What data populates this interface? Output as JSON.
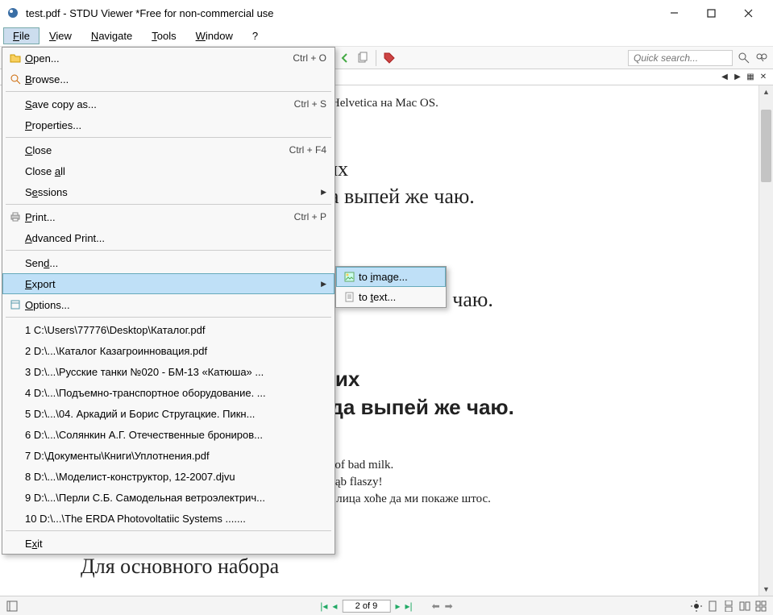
{
  "titlebar": {
    "title": "test.pdf - STDU Viewer *Free for non-commercial use"
  },
  "menubar": {
    "file": "File",
    "view": "View",
    "navigate": "Navigate",
    "tools": "Tools",
    "window": "Window",
    "help": "?"
  },
  "toolbar": {
    "search_placeholder": "Quick search..."
  },
  "fileMenu": {
    "open": "Open...",
    "open_sc": "Ctrl + O",
    "browse": "Browse...",
    "savecopy": "Save copy as...",
    "savecopy_sc": "Ctrl + S",
    "properties": "Properties...",
    "close": "Close",
    "close_sc": "Ctrl + F4",
    "closeall": "Close all",
    "sessions": "Sessions",
    "print": "Print...",
    "print_sc": "Ctrl + P",
    "advprint": "Advanced Print...",
    "send": "Send...",
    "export": "Export",
    "options": "Options...",
    "recent": [
      "1 C:\\Users\\77776\\Desktop\\Каталог.pdf",
      "2 D:\\...\\Каталог Казагроинновация.pdf",
      "3 D:\\...\\Русские танки №020 - БМ-13 «Катюша» ...",
      "4 D:\\...\\Подъемно-транспортное оборудование. ...",
      "5 D:\\...\\04. Аркадий и Борис Стругацкие. Пикн...",
      "6 D:\\...\\Солянкин А.Г. Отечественные брониров...",
      "7 D:\\Документы\\Книги\\Уплотнения.pdf",
      "8 D:\\...\\Моделист-конструктор, 12-2007.djvu",
      "9 D:\\...\\Перли С.Б. Самодельная ветроэлектрич...",
      "10 D:\\...\\The ERDA Photovoltatiic Systems ......."
    ],
    "exit": "Exit"
  },
  "exportSubmenu": {
    "toimage": "to image...",
    "totext": "to text..."
  },
  "document": {
    "topline": "на Windows и Helvetica на Mac OS.",
    "line1a": "их мягких",
    "line1b": "булок, да выпей же чаю.",
    "line2": "выпей же чаю.",
    "line3a": "их мягких",
    "line3b": "булок, да выпей же чаю.",
    "s1": "vaves quart jug of bad milk.",
    "s2": "chmurność w głąb flaszy!",
    "s3": "ерџија чађавог лица хоће да ми покаже штос.",
    "bottom": "Для основного набора"
  },
  "statusbar": {
    "page": "2 of 9"
  }
}
